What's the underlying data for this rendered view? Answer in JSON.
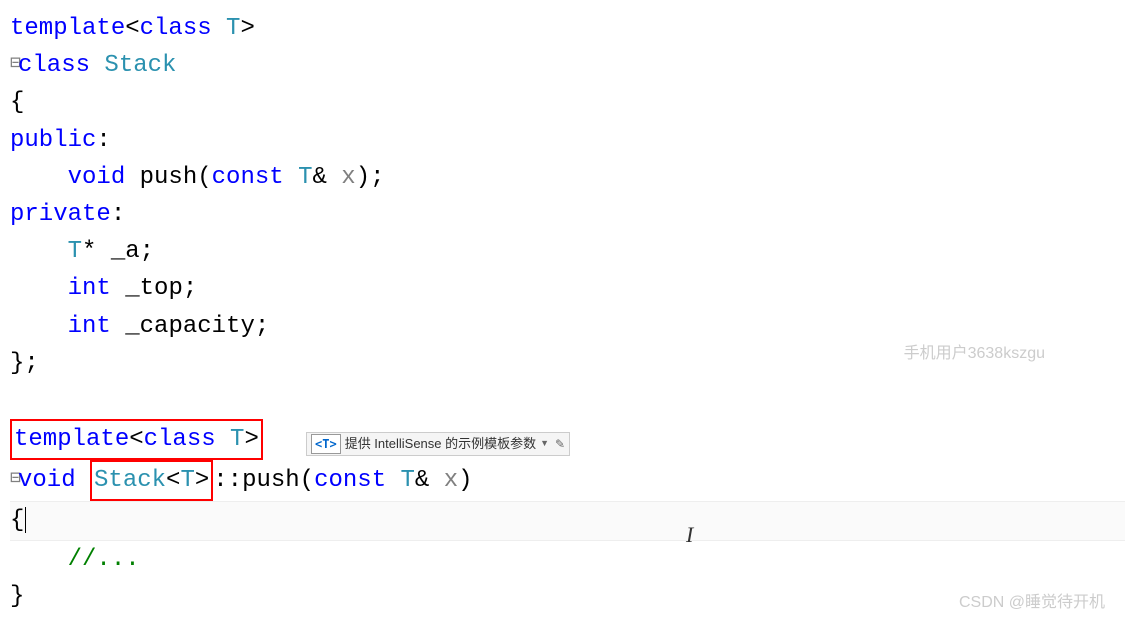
{
  "code": {
    "line1": {
      "template": "template",
      "open": "<",
      "class": "class",
      "space": " ",
      "t": "T",
      "close": ">"
    },
    "line2": {
      "class": "class",
      "space": " ",
      "name": "Stack"
    },
    "line3": "{",
    "line4": {
      "public": "public",
      "colon": ":"
    },
    "line5": {
      "indent": "    ",
      "void": "void",
      "space": " ",
      "push": "push",
      "open": "(",
      "const": "const",
      "space2": " ",
      "t": "T",
      "amp": "& ",
      "x": "x",
      "close": ");"
    },
    "line6": {
      "private": "private",
      "colon": ":"
    },
    "line7": {
      "indent": "    ",
      "t": "T",
      "rest": "* _a;"
    },
    "line8": {
      "indent": "    ",
      "int": "int",
      "rest": " _top;"
    },
    "line9": {
      "indent": "    ",
      "int": "int",
      "rest": " _capacity;"
    },
    "line10": "};",
    "line12": {
      "template": "template",
      "open": "<",
      "class": "class",
      "space": " ",
      "t": "T",
      "close": ">"
    },
    "line13": {
      "void": "void",
      "space": " ",
      "stack": "Stack",
      "open": "<",
      "t": "T",
      "close": ">",
      "scope": "::",
      "push": "push",
      "popen": "(",
      "const": "const",
      "space2": " ",
      "t2": "T",
      "amp": "& ",
      "x": "x",
      "pclose": ")"
    },
    "line14": "{",
    "line15": {
      "indent": "    ",
      "comment": "//..."
    },
    "line16": "}"
  },
  "tooltip": {
    "icon": "<T>",
    "text": "提供 IntelliSense 的示例模板参数",
    "dropdown": "▼",
    "edit": "✎"
  },
  "watermark1": "手机用户3638kszgu",
  "watermark2": "CSDN @睡觉待开机"
}
